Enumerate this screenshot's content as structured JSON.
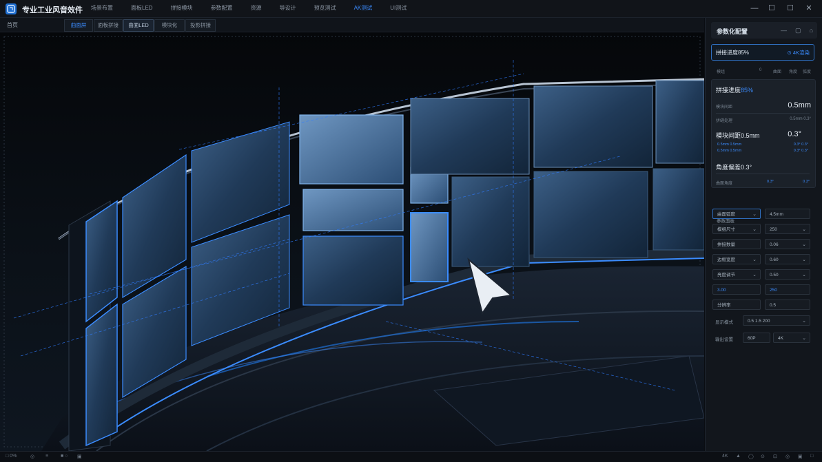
{
  "app": {
    "title": "专业工业风音效件",
    "menu": [
      "场景布置",
      "面板LED",
      "拼接模块",
      "参数配置",
      "资源",
      "导设计",
      "预览测试",
      "AK测试",
      "UI测试"
    ],
    "active_menu_index": 7,
    "window_controls": [
      "—",
      "☐",
      "☐",
      "✕"
    ]
  },
  "tabs": {
    "home": "首页",
    "items": [
      "曲面屏",
      "面板拼接",
      "曲面LED",
      "模块化",
      "投影拼接"
    ],
    "active_index": 2
  },
  "panel": {
    "title": "参数化配置",
    "header_icons": [
      "minus-icon",
      "copy-icon",
      "home-icon"
    ],
    "progress": {
      "label": "拼接进度85%",
      "value": 85,
      "right": "⊙ 4K渲染"
    },
    "sub_row": [
      "模组",
      "0",
      "曲面",
      "角度",
      "弧度"
    ],
    "card": {
      "title_prefix": "拼接进度",
      "title_value": "85%",
      "gap_label": "模块间距",
      "gap_value": "0.5mm",
      "bezel_label": "拼缝处理",
      "bezel_right": "0.5mm 0.3°",
      "mid_title": "模块间距0.5mm",
      "mid_value": "0.3°",
      "blue_left_1": "0.5mm 0.5mm",
      "blue_left_2": "0.5mm 0.5mm",
      "blue_right_1": "0.3° 0.3°",
      "blue_right_2": "0.3° 0.3°",
      "angle_title": "角度偏差0.3°",
      "bottom_label": "曲面角度",
      "bottom_mid": "0.3°",
      "bottom_right": "0.3°"
    },
    "section_label": "参数面板",
    "fields": [
      [
        "曲面弧度",
        "4.5mm"
      ],
      [
        "模组尺寸",
        "250"
      ],
      [
        "拼接数量",
        "0.06"
      ],
      [
        "边框宽度",
        "0.60"
      ],
      [
        "亮度调节",
        "0.50"
      ],
      [
        "3.00",
        "250"
      ],
      [
        "分辨率",
        "0.5"
      ]
    ],
    "row1_label": "显示模式",
    "row1_value": "0.5 1.5 200",
    "row2_label": "输出设置",
    "row2_v1": "60P",
    "row2_v2": "4K"
  },
  "status": [
    "□ 0%",
    "◎",
    "≡",
    "■ ○",
    "▣"
  ],
  "status_right": [
    "4K",
    "▲",
    "◯",
    "⊙",
    "⊡",
    "◎",
    "▣",
    "□"
  ]
}
